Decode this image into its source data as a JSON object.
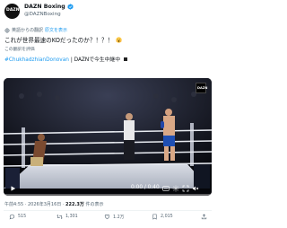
{
  "account": {
    "display_name": "DAZN Boxing",
    "handle": "@DAZNBoxing",
    "avatar_text": "DAZN",
    "verified": true
  },
  "translation_note": {
    "text": "英語からの翻訳",
    "link": "原文を表示"
  },
  "tweet": {
    "text": "これが世界最速のKOだったのか？！？！",
    "emoji": "scream-face-icon",
    "rate_translation": "この翻訳を評価",
    "hashtag": "#ChukhadzhianDonovan",
    "hashtag_rest": "| DAZNで今生中継中"
  },
  "video": {
    "badge_text": "DAZN",
    "time": "0:00 / 0:40"
  },
  "meta": {
    "timestamp": "午前4:55 · 2026年3月16日 · ",
    "views": "222.3万",
    "views_label": " 件の表示"
  },
  "actions": {
    "replies": "515",
    "retweets": "1,301",
    "likes": "1.2万",
    "bookmarks": "2,015"
  },
  "colors": {
    "link": "#1d9bf0",
    "text": "#0f1419",
    "secondary": "#536471",
    "verified": "#1d9bf0"
  }
}
